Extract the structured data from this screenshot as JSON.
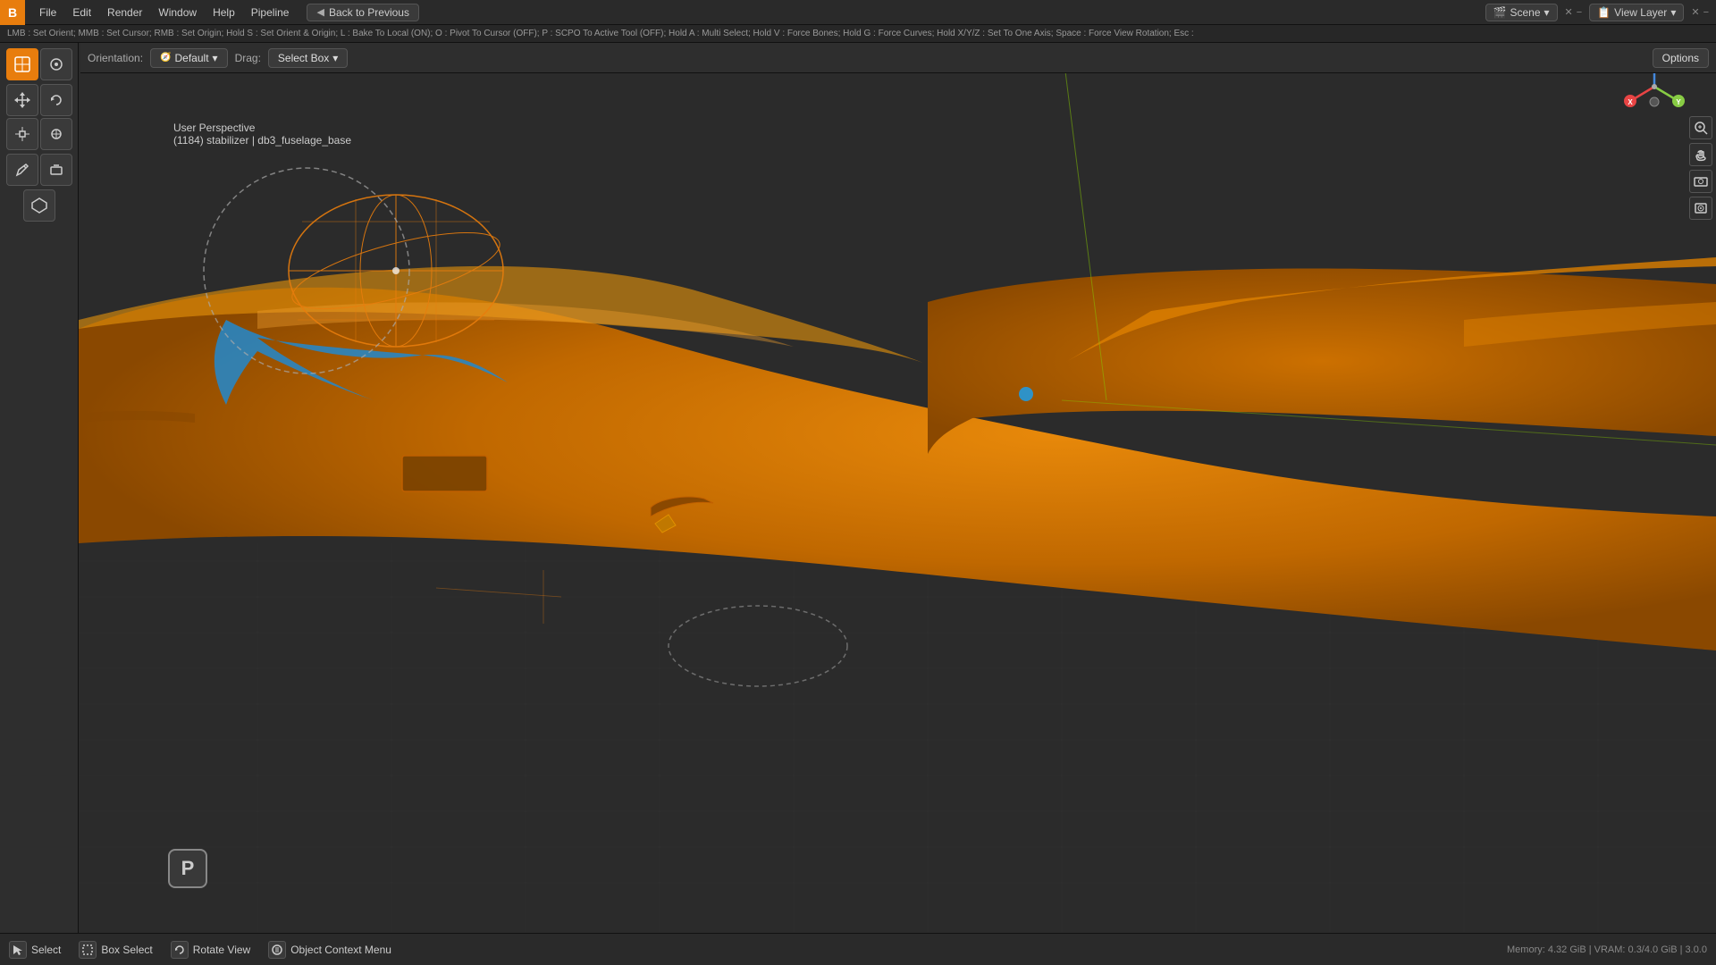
{
  "topbar": {
    "logo": "B",
    "menus": [
      "File",
      "Edit",
      "Render",
      "Window",
      "Help",
      "Pipeline"
    ],
    "back_button": "Back to Previous",
    "back_icon": "◀",
    "scene_label": "Scene",
    "viewlayer_label": "View Layer",
    "scene_icon": "🎬",
    "viewlayer_icon": "📋"
  },
  "shortcut_bar": {
    "text": "LMB : Set Orient;  MMB : Set Cursor;  RMB : Set Origin;  Hold S : Set Orient & Origin;  L : Bake To Local (ON);  O : Pivot To Cursor (OFF);  P : SCPO To Active Tool (OFF);  Hold A : Multi Select;  Hold V : Force Bones;  Hold G : Force Curves;  Hold X/Y/Z : Set To One Axis;  Space : Force View Rotation;  Esc :"
  },
  "toolbar": {
    "orientation_label": "Orientation:",
    "orientation_value": "Default",
    "drag_label": "Drag:",
    "drag_value": "Select Box",
    "options_label": "Options"
  },
  "viewport": {
    "label_line1": "User Perspective",
    "label_line2": "(1184) stabilizer | db3_fuselage_base"
  },
  "left_tools": {
    "select_icon": "⊕",
    "cursor_icon": "⊙",
    "move_icon": "✥",
    "rotate_icon": "↻",
    "scale_icon": "⤢",
    "transform_icon": "⟲",
    "annotate_icon": "✏",
    "annotate2_icon": "▱",
    "measure_icon": "⬡"
  },
  "right_icons": {
    "zoom_icon": "🔍",
    "grab_icon": "✋",
    "scene_icon": "🎬",
    "render_icon": "📷"
  },
  "status_bar": {
    "select_icon": "⊕",
    "select_label": "Select",
    "box_select_icon": "▭",
    "box_select_label": "Box Select",
    "rotate_view_icon": "↻",
    "rotate_view_label": "Rotate View",
    "context_menu_icon": "☰",
    "context_menu_label": "Object Context Menu",
    "memory_label": "Memory: 4.32 GiB | VRAM: 0.3/4.0 GiB | 3.0.0"
  },
  "p_icon": "P",
  "orientation_gizmo": {
    "x_color": "#e84444",
    "y_color": "#88cc44",
    "z_color": "#4488dd",
    "dot_color": "#999"
  }
}
